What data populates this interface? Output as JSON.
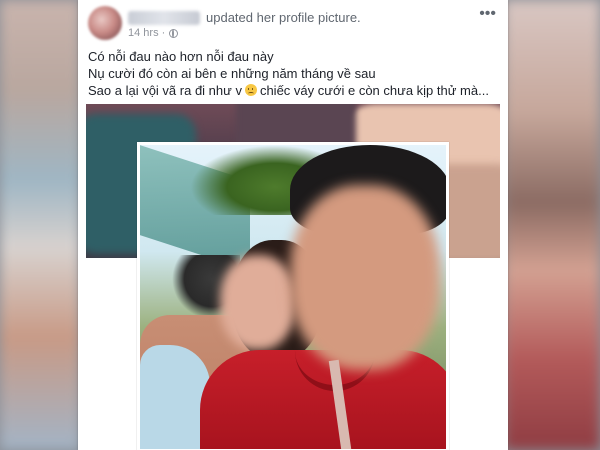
{
  "post": {
    "action_text": "updated her profile picture.",
    "timestamp": "14 hrs",
    "separator": "·",
    "privacy_icon": "globe-icon",
    "more_icon": "more-options-icon",
    "more_glyph": "•••",
    "lines": [
      "Có nỗi đau nào hơn nỗi đau này",
      "Nụ cười đó còn ai bên e những năm tháng về sau",
      "Sao a lại vội vã ra đi như v",
      "chiếc váy cưới e còn chưa kịp thử mà..."
    ],
    "emoji": "sad-face-emoji"
  },
  "colors": {
    "card_bg": "#ffffff",
    "text_primary": "#1d2129",
    "text_secondary": "#606770",
    "text_meta": "#90949c"
  }
}
